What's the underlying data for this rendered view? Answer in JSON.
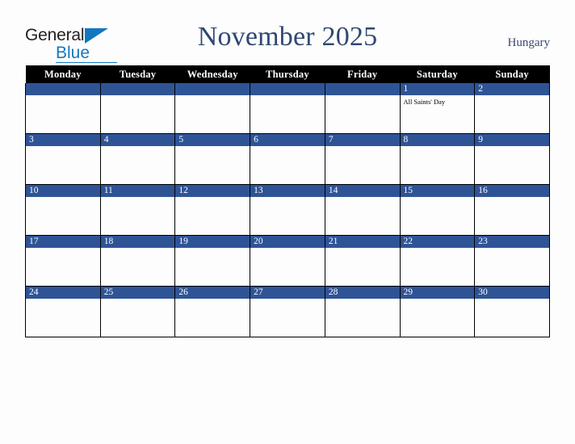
{
  "brand": {
    "logo_text_1": "General",
    "logo_text_2": "Blue",
    "triangle_icon": "blue-triangle-icon",
    "primary_color": "#1278be"
  },
  "header": {
    "title": "November 2025",
    "country": "Hungary",
    "title_color": "#2f4874"
  },
  "calendar": {
    "month": "November",
    "year": "2025",
    "accent_color": "#2f5496",
    "header_bg": "#000000",
    "weekday_headers": [
      "Monday",
      "Tuesday",
      "Wednesday",
      "Thursday",
      "Friday",
      "Saturday",
      "Sunday"
    ],
    "weeks": [
      [
        {
          "date": "",
          "events": []
        },
        {
          "date": "",
          "events": []
        },
        {
          "date": "",
          "events": []
        },
        {
          "date": "",
          "events": []
        },
        {
          "date": "",
          "events": []
        },
        {
          "date": "1",
          "events": [
            "All Saints' Day"
          ]
        },
        {
          "date": "2",
          "events": []
        }
      ],
      [
        {
          "date": "3",
          "events": []
        },
        {
          "date": "4",
          "events": []
        },
        {
          "date": "5",
          "events": []
        },
        {
          "date": "6",
          "events": []
        },
        {
          "date": "7",
          "events": []
        },
        {
          "date": "8",
          "events": []
        },
        {
          "date": "9",
          "events": []
        }
      ],
      [
        {
          "date": "10",
          "events": []
        },
        {
          "date": "11",
          "events": []
        },
        {
          "date": "12",
          "events": []
        },
        {
          "date": "13",
          "events": []
        },
        {
          "date": "14",
          "events": []
        },
        {
          "date": "15",
          "events": []
        },
        {
          "date": "16",
          "events": []
        }
      ],
      [
        {
          "date": "17",
          "events": []
        },
        {
          "date": "18",
          "events": []
        },
        {
          "date": "19",
          "events": []
        },
        {
          "date": "20",
          "events": []
        },
        {
          "date": "21",
          "events": []
        },
        {
          "date": "22",
          "events": []
        },
        {
          "date": "23",
          "events": []
        }
      ],
      [
        {
          "date": "24",
          "events": []
        },
        {
          "date": "25",
          "events": []
        },
        {
          "date": "26",
          "events": []
        },
        {
          "date": "27",
          "events": []
        },
        {
          "date": "28",
          "events": []
        },
        {
          "date": "29",
          "events": []
        },
        {
          "date": "30",
          "events": []
        }
      ]
    ]
  }
}
